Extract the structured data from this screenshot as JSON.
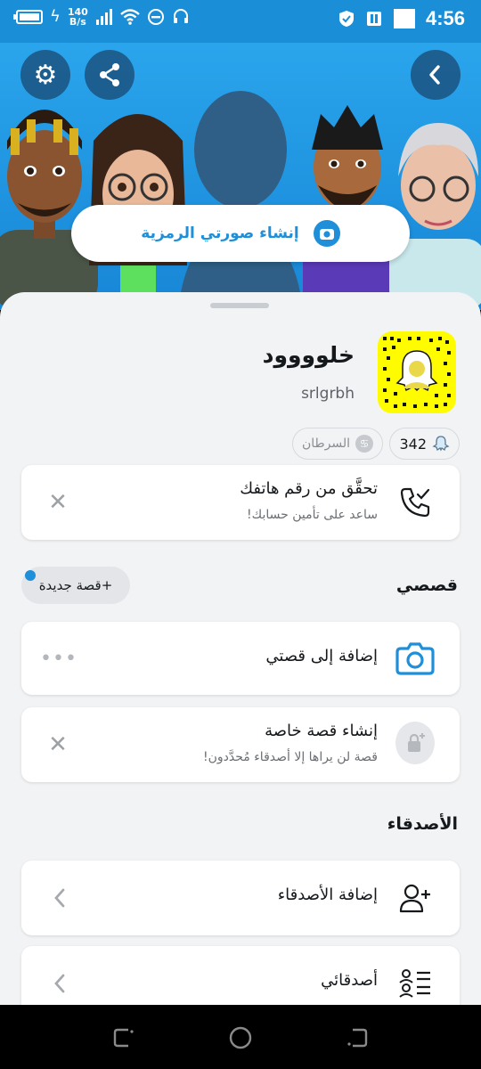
{
  "status_bar": {
    "net_speed_value": "140",
    "net_speed_unit": "B/s",
    "time": "4:56"
  },
  "hero": {
    "create_bitmoji_label": "إنشاء صورتي الرمزية"
  },
  "profile": {
    "display_name": "خلوووود",
    "username": "srlgrbh",
    "snap_score": "342",
    "zodiac": "السرطان"
  },
  "verify_card": {
    "title": "تحقَّق من رقم هاتفك",
    "subtitle": "ساعد على تأمين حسابك!"
  },
  "stories_section": {
    "title": "قصصي",
    "new_story_label": "+قصة جديدة",
    "add_to_story": "إضافة إلى قصتي",
    "private_story_title": "إنشاء قصة خاصة",
    "private_story_subtitle": "قصة لن يراها إلا أصدقاء مُحدَّدون!"
  },
  "friends_section": {
    "title": "الأصدقاء",
    "add_friends": "إضافة الأصدقاء",
    "my_friends": "أصدقائي"
  },
  "colors": {
    "snap_yellow": "#FFFC00",
    "accent_blue": "#1E8FD8",
    "hero_blue": "#2AA5EC"
  }
}
